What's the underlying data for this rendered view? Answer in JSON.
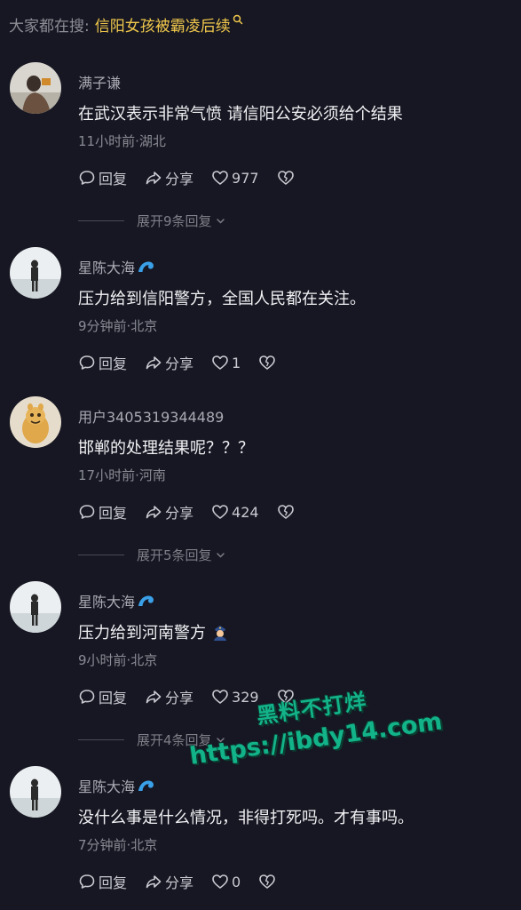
{
  "search": {
    "prefix": "大家都在搜:",
    "term": "信阳女孩被霸凌后续",
    "icon": "search-icon"
  },
  "comments": [
    {
      "username": "满子谦",
      "badge": false,
      "text": "在武汉表示非常气愤 请信阳公安必须给个结果",
      "meta": "11小时前·湖北",
      "reply_label": "回复",
      "share_label": "分享",
      "likes": "977",
      "expand_label": "展开9条回复"
    },
    {
      "username": "星陈大海",
      "badge": true,
      "text": "压力给到信阳警方，全国人民都在关注。",
      "meta": "9分钟前·北京",
      "reply_label": "回复",
      "share_label": "分享",
      "likes": "1"
    },
    {
      "username": "用户3405319344489",
      "badge": false,
      "text": "邯郸的处理结果呢？？？",
      "meta": "17小时前·河南",
      "reply_label": "回复",
      "share_label": "分享",
      "likes": "424",
      "expand_label": "展开5条回复"
    },
    {
      "username": "星陈大海",
      "badge": true,
      "text": "压力给到河南警方",
      "meta": "9小时前·北京",
      "reply_label": "回复",
      "share_label": "分享",
      "likes": "329",
      "expand_label": "展开4条回复",
      "emoji": "police-officer-emoji"
    },
    {
      "username": "星陈大海",
      "badge": true,
      "text": "没什么事是什么情况，非得打死吗。才有事吗。",
      "meta": "7分钟前·北京",
      "reply_label": "回复",
      "share_label": "分享",
      "likes": "0"
    }
  ],
  "watermark": {
    "line1": "黑料不打烊",
    "line2": "https://ibdy14.com"
  },
  "colors": {
    "background": "#161722",
    "search_term": "#f2c94c",
    "watermark": "#13b38a",
    "badge": "#3aa0e8"
  }
}
